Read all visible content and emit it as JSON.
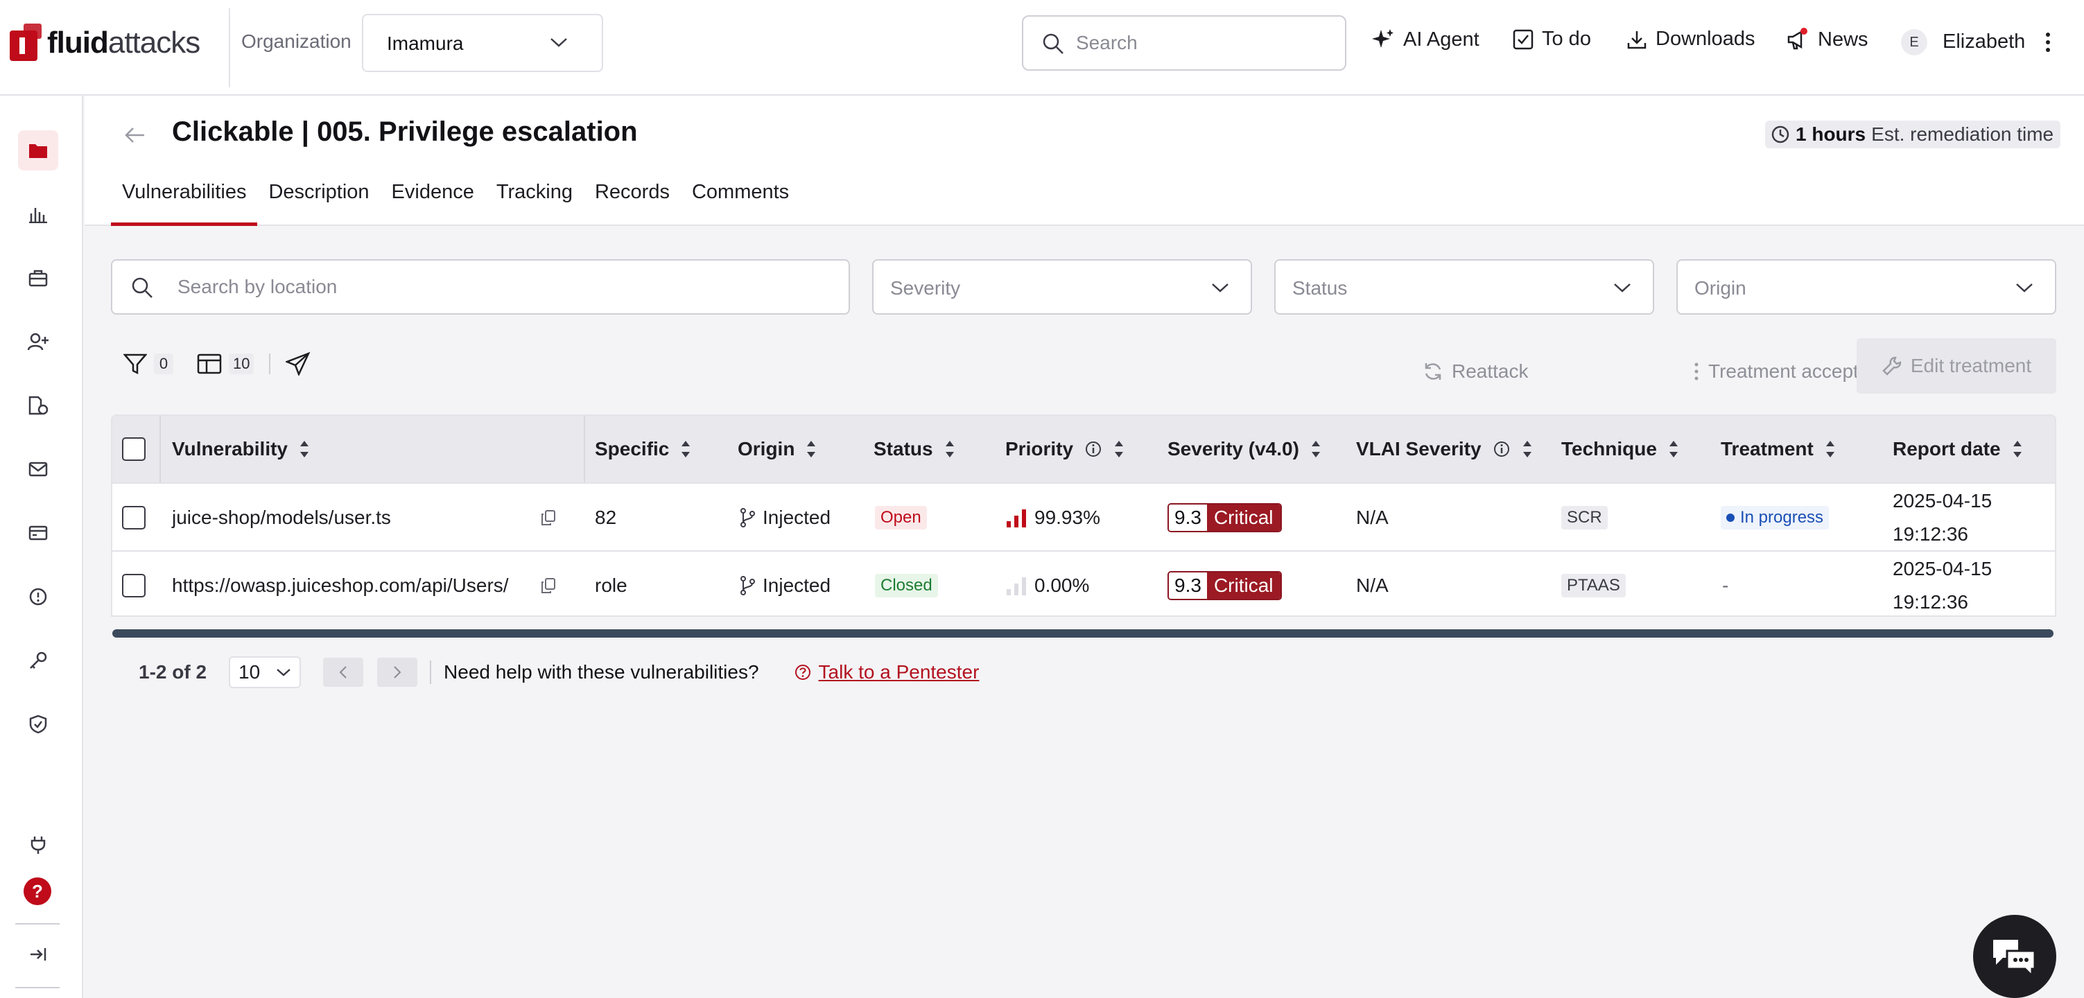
{
  "brand": {
    "name_bold": "fluid",
    "name_light": "attacks",
    "color": "#bf0b1a"
  },
  "topbar": {
    "org_label": "Organization",
    "org_value": "Imamura",
    "search_placeholder": "Search",
    "actions": [
      {
        "label": "AI Agent",
        "icon": "sparkle-icon"
      },
      {
        "label": "To do",
        "icon": "checkbox-icon"
      },
      {
        "label": "Downloads",
        "icon": "download-icon"
      },
      {
        "label": "News",
        "icon": "megaphone-icon"
      }
    ],
    "user_initial": "E",
    "user_name": "Elizabeth"
  },
  "sidebar": {
    "items": [
      "folder-icon",
      "chart-icon",
      "briefcase-icon",
      "user-add-icon",
      "document-money-icon",
      "mail-icon",
      "credit-card-icon",
      "alert-icon",
      "key-icon",
      "shield-icon"
    ],
    "bottom": [
      "plug-icon",
      "help-icon",
      "collapse-icon"
    ],
    "help_glyph": "?"
  },
  "header": {
    "title": "Clickable | 005. Privilege escalation",
    "est_value": "1 hours",
    "est_label": "Est. remediation time",
    "tabs": [
      "Vulnerabilities",
      "Description",
      "Evidence",
      "Tracking",
      "Records",
      "Comments"
    ]
  },
  "filters": {
    "search_placeholder": "Search by location",
    "severity": "Severity",
    "status": "Status",
    "origin": "Origin"
  },
  "toolbar": {
    "filter_count": "0",
    "columns_count": "10",
    "reattack": "Reattack",
    "treatment_acceptance": "Treatment acceptance",
    "edit_treatment": "Edit treatment"
  },
  "table": {
    "columns": [
      "Vulnerability",
      "Specific",
      "Origin",
      "Status",
      "Priority",
      "Severity (v4.0)",
      "VLAI Severity",
      "Technique",
      "Treatment",
      "Report date"
    ],
    "rows": [
      {
        "vulnerability": "juice-shop/models/user.ts",
        "specific": "82",
        "origin": "Injected",
        "status": "Open",
        "priority": "99.93%",
        "severity_score": "9.3",
        "severity_label": "Critical",
        "vlai": "N/A",
        "technique": "SCR",
        "treatment": "In progress",
        "date": "2025-04-15",
        "time": "19:12:36"
      },
      {
        "vulnerability": "https://owasp.juiceshop.com/api/Users/",
        "specific": "role",
        "origin": "Injected",
        "status": "Closed",
        "priority": "0.00%",
        "severity_score": "9.3",
        "severity_label": "Critical",
        "vlai": "N/A",
        "technique": "PTAAS",
        "treatment": "-",
        "date": "2025-04-15",
        "time": "19:12:36"
      }
    ]
  },
  "pagination": {
    "info": "1-2 of 2",
    "page_size": "10",
    "help_text": "Need help with these vulnerabilities?",
    "pentester_link": "Talk to a Pentester"
  }
}
